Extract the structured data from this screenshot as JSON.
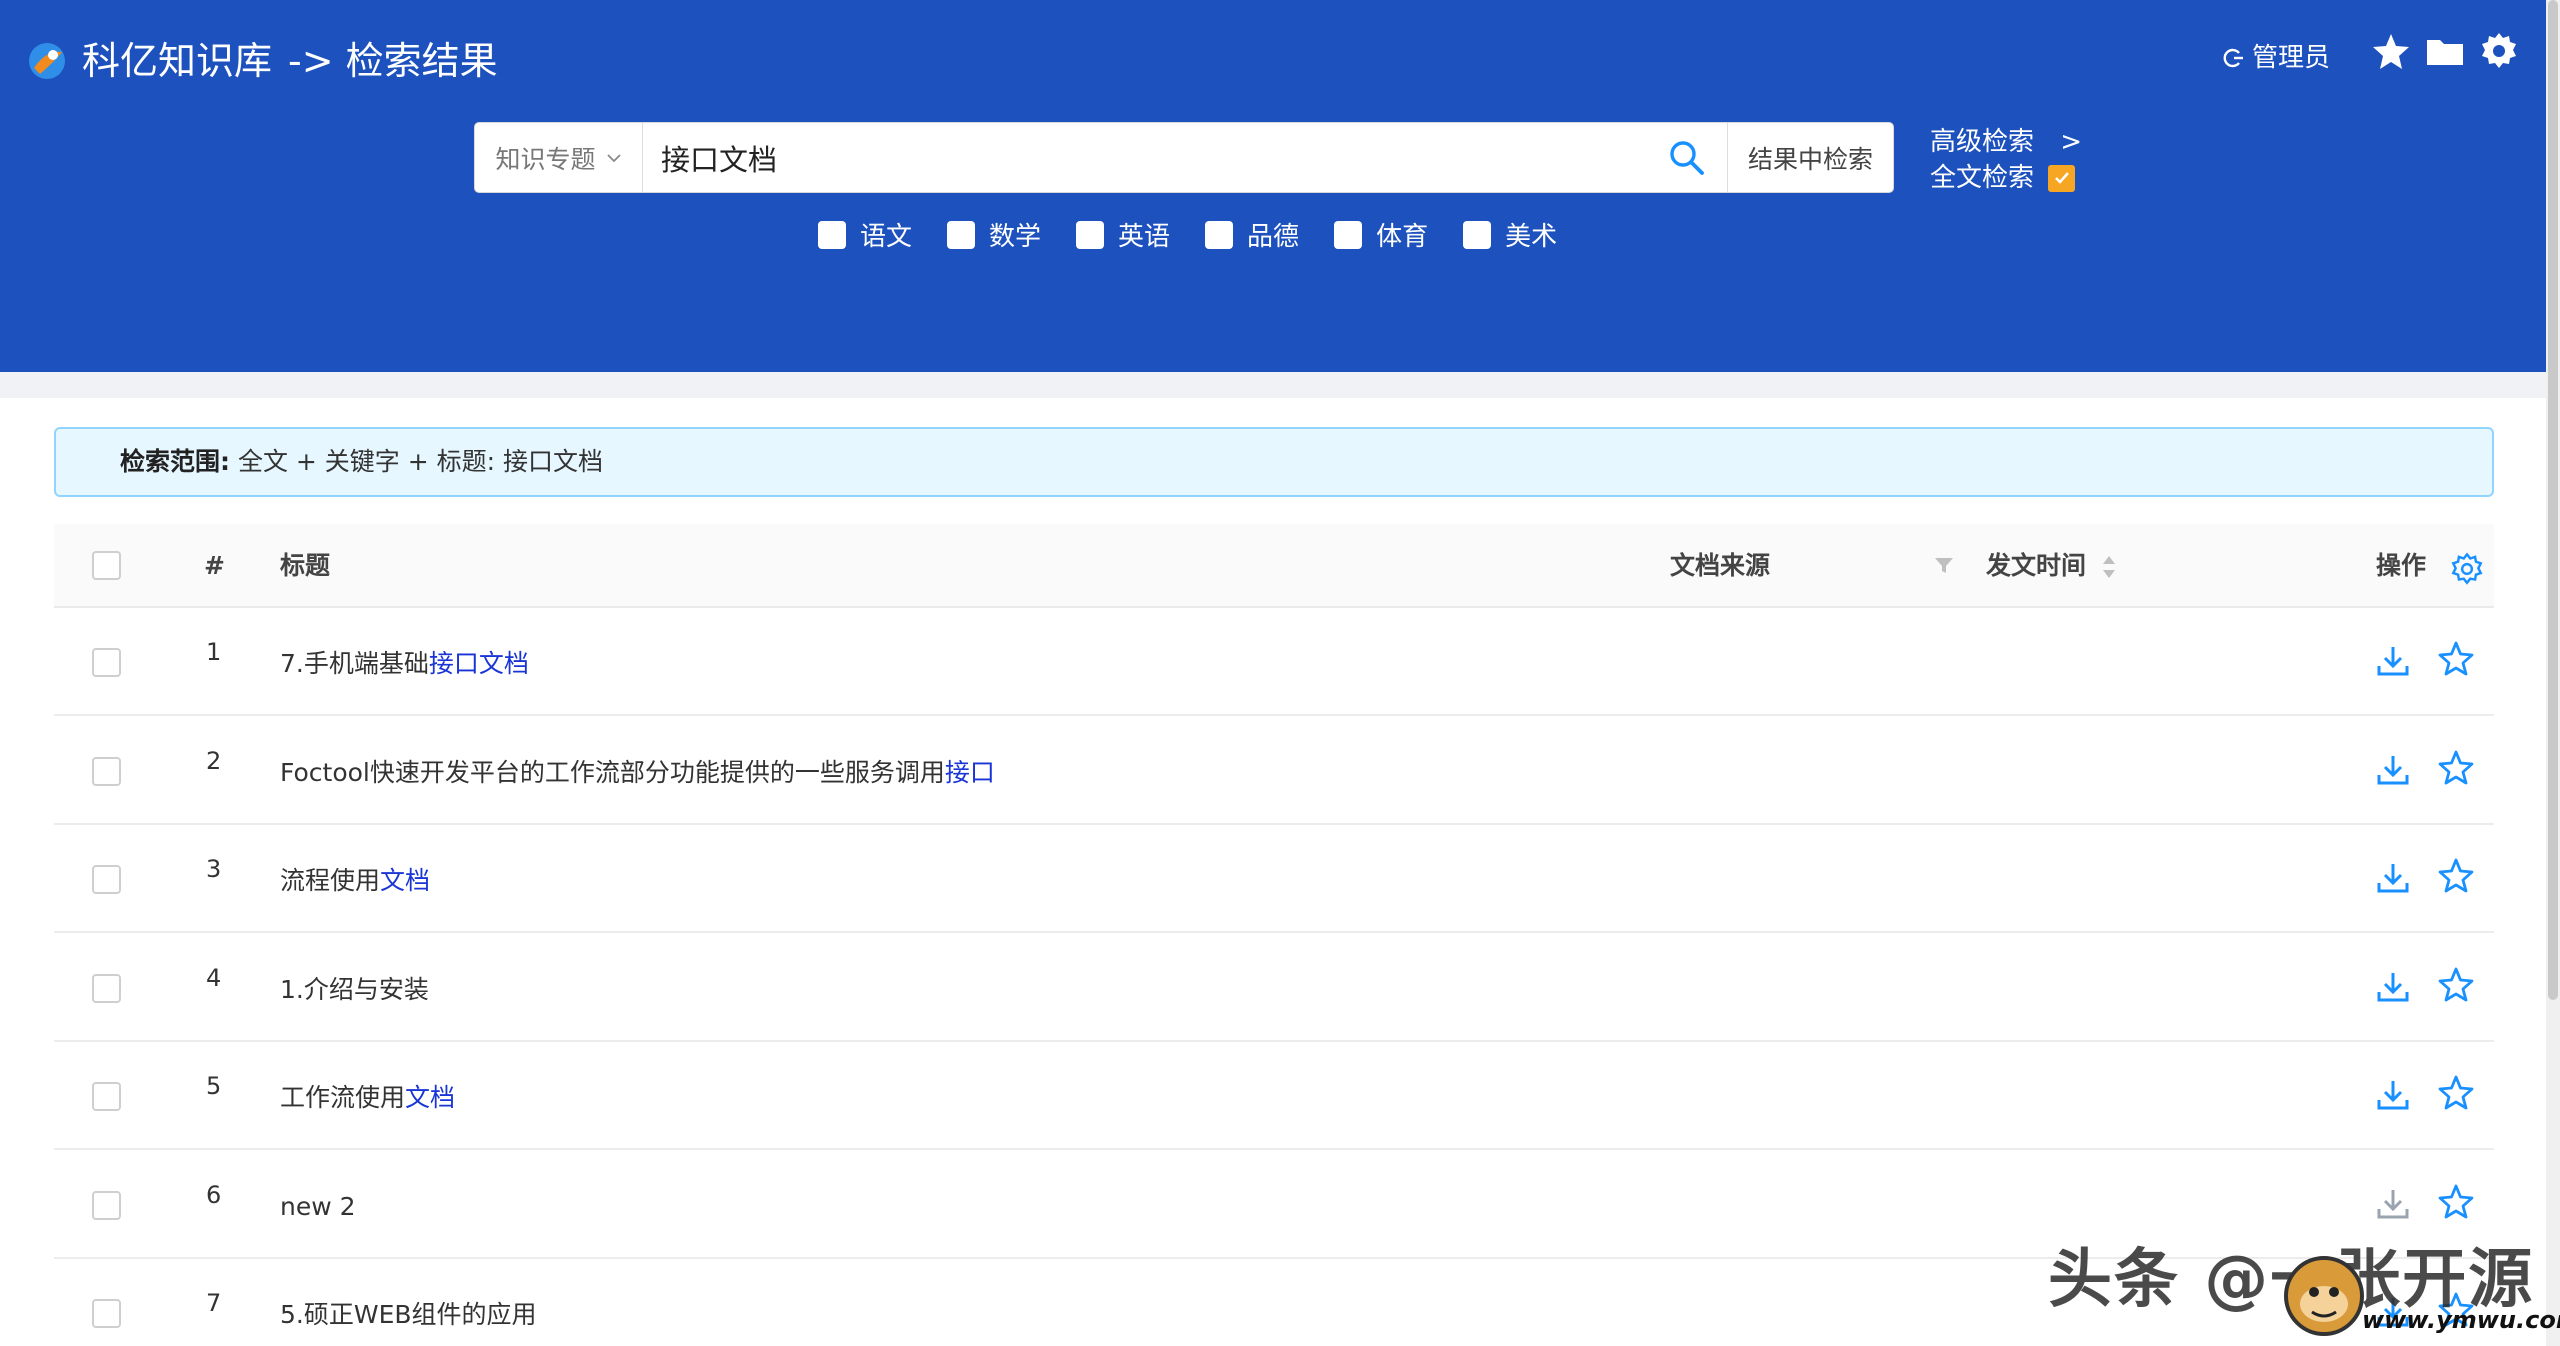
{
  "header": {
    "app_title": "科亿知识库",
    "breadcrumb": "-> 检索结果",
    "user_label": "管理员",
    "bg_color": "#1d51bd"
  },
  "search": {
    "category_select": "知识专题",
    "query": "接口文档",
    "search_in_results": "结果中检索",
    "advanced_label": "高级检索",
    "advanced_arrow": ">",
    "fulltext_label": "全文检索",
    "fulltext_checked": true
  },
  "subjects": [
    "语文",
    "数学",
    "英语",
    "品德",
    "体育",
    "美术"
  ],
  "scope": {
    "label": "检索范围:",
    "value": "全文 + 关键字 + 标题: 接口文档"
  },
  "table": {
    "headers": {
      "index": "#",
      "title": "标题",
      "source": "文档来源",
      "date": "发文时间",
      "action": "操作"
    },
    "rows": [
      {
        "index": "1",
        "title_pre": "7.手机端基础",
        "title_hl": "接口文档"
      },
      {
        "index": "2",
        "title_pre": "Foctool快速开发平台的工作流部分功能提供的一些服务调用",
        "title_hl": "接口"
      },
      {
        "index": "3",
        "title_pre": "流程使用",
        "title_hl": "文档"
      },
      {
        "index": "4",
        "title_pre": "1.介绍与安装",
        "title_hl": ""
      },
      {
        "index": "5",
        "title_pre": "工作流使用",
        "title_hl": "文档"
      },
      {
        "index": "6",
        "title_pre": "new 2",
        "title_hl": ""
      },
      {
        "index": "7",
        "title_pre": "5.硕正WEB组件的应用",
        "title_hl": ""
      }
    ]
  },
  "watermark": {
    "text": "头条 @一张开源",
    "site": "www.ymwu.com"
  },
  "colors": {
    "accent": "#1890ff",
    "highlight": "#1a35d6",
    "checkbox_checked": "#f6a623"
  }
}
